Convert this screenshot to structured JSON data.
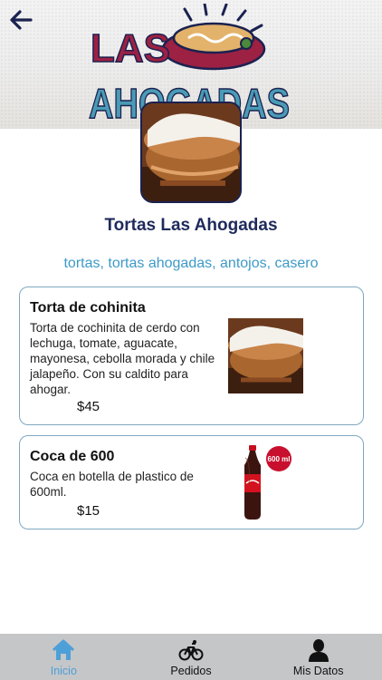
{
  "header": {
    "back_icon": "arrow-left-icon",
    "logo_text_line1": "LAS",
    "logo_text_line2": "AHOGADAS"
  },
  "store": {
    "name": "Tortas Las Ahogadas",
    "tags": "tortas, tortas ahogadas, antojos, casero"
  },
  "products": [
    {
      "title": "Torta de cohinita",
      "description": "Torta de cochinita de cerdo con lechuga, tomate, aguacate, mayonesa, cebolla morada y chile jalapeño. Con su caldito para ahogar.",
      "price": "$45"
    },
    {
      "title": "Coca de 600",
      "description": "Coca en botella de plastico de 600ml.",
      "price": "$15",
      "badge": "600 ml"
    }
  ],
  "nav": {
    "items": [
      {
        "label": "Inicio",
        "icon": "home-icon",
        "active": true
      },
      {
        "label": "Pedidos",
        "icon": "bicycle-icon",
        "active": false
      },
      {
        "label": "Mis Datos",
        "icon": "user-icon",
        "active": false
      }
    ]
  },
  "colors": {
    "accent": "#4d9fd8",
    "title": "#1f2a5c",
    "tags": "#3d9ac7",
    "card_border": "#7fa8bf",
    "nav_bg": "#c4c6c8"
  }
}
